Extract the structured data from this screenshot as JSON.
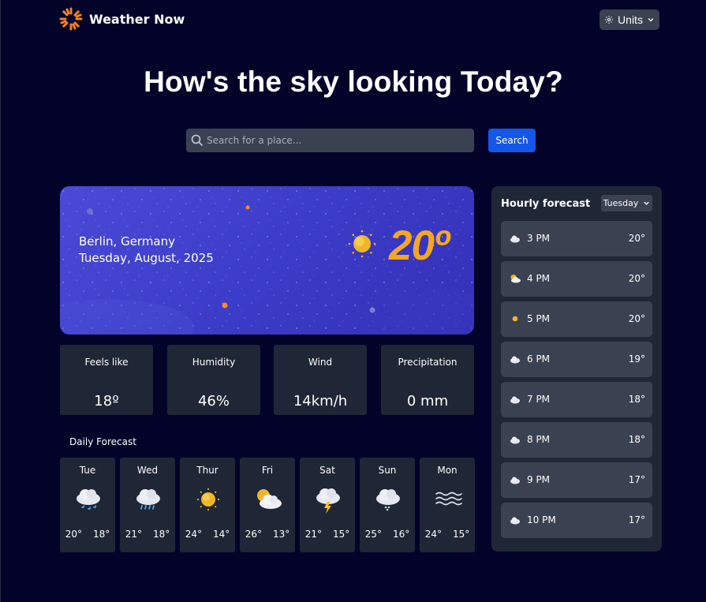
{
  "app": {
    "name": "Weather Now",
    "icon": "sun-logo-icon",
    "accent": "#f5a623"
  },
  "header": {
    "units_label": "Units"
  },
  "title": "How's the sky looking Today?",
  "search": {
    "placeholder": "Search for a place...",
    "button_label": "Search"
  },
  "current": {
    "location": "Berlin, Germany",
    "date": "Tuesday, August, 2025",
    "icon": "sun-icon",
    "temperature": "20º"
  },
  "stats": [
    {
      "label": "Feels like",
      "value": "18º"
    },
    {
      "label": "Humidity",
      "value": "46%"
    },
    {
      "label": "Wind",
      "value": "14km/h"
    },
    {
      "label": "Precipitation",
      "value": "0 mm"
    }
  ],
  "daily": {
    "title": "Daily Forecast",
    "days": [
      {
        "name": "Tue",
        "icon": "rain-cloud-icon",
        "high": "20°",
        "low": "18°"
      },
      {
        "name": "Wed",
        "icon": "drizzle-cloud-icon",
        "high": "21°",
        "low": "18°"
      },
      {
        "name": "Thur",
        "icon": "sun-icon",
        "high": "24°",
        "low": "14°"
      },
      {
        "name": "Fri",
        "icon": "partly-cloudy-icon",
        "high": "26°",
        "low": "13°"
      },
      {
        "name": "Sat",
        "icon": "storm-cloud-icon",
        "high": "21°",
        "low": "15°"
      },
      {
        "name": "Sun",
        "icon": "snow-cloud-icon",
        "high": "25°",
        "low": "16°"
      },
      {
        "name": "Mon",
        "icon": "fog-icon",
        "high": "24°",
        "low": "15°"
      }
    ]
  },
  "hourly": {
    "title": "Hourly forecast",
    "selected_day": "Tuesday",
    "hours": [
      {
        "time": "3 PM",
        "icon": "cloud-icon",
        "temp": "20°"
      },
      {
        "time": "4 PM",
        "icon": "partly-cloudy-icon",
        "temp": "20°"
      },
      {
        "time": "5 PM",
        "icon": "sun-icon",
        "temp": "20°"
      },
      {
        "time": "6 PM",
        "icon": "cloud-icon",
        "temp": "19°"
      },
      {
        "time": "7 PM",
        "icon": "cloud-icon",
        "temp": "18°"
      },
      {
        "time": "8 PM",
        "icon": "cloud-icon",
        "temp": "18°"
      },
      {
        "time": "9 PM",
        "icon": "cloud-icon",
        "temp": "17°"
      },
      {
        "time": "10 PM",
        "icon": "cloud-icon",
        "temp": "17°"
      }
    ]
  }
}
